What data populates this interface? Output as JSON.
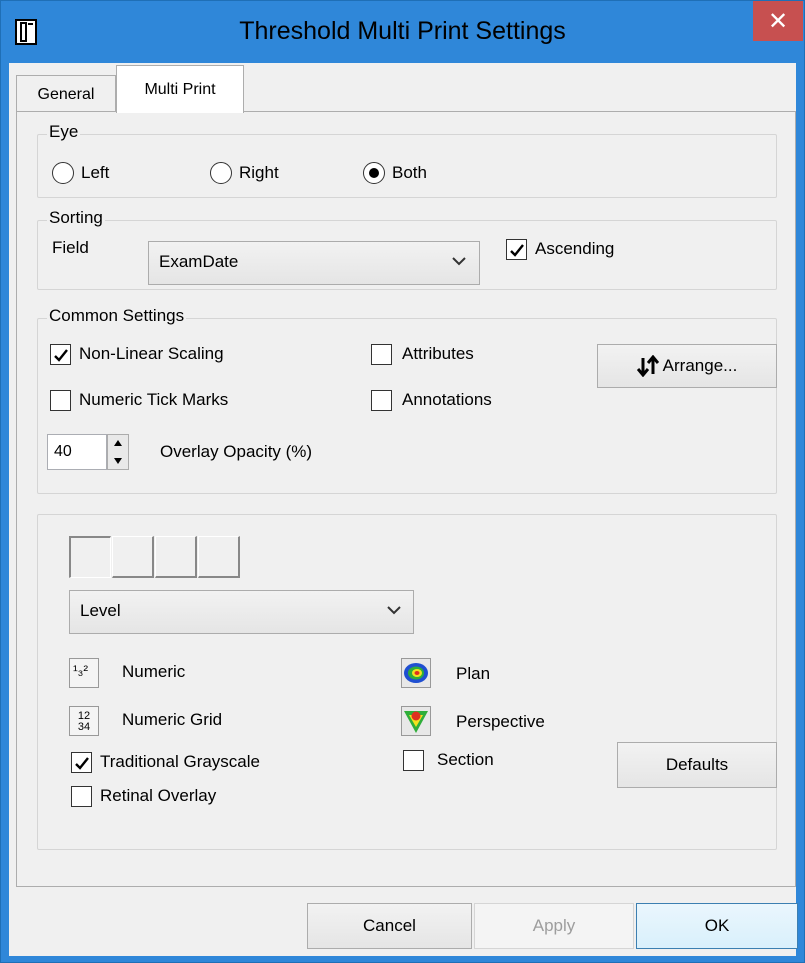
{
  "window": {
    "title": "Threshold Multi Print Settings",
    "close_glyph": "✕"
  },
  "tabs": [
    {
      "label": "General",
      "active": false
    },
    {
      "label": "Multi Print",
      "active": true
    }
  ],
  "eye": {
    "label": "Eye",
    "options": [
      {
        "label": "Left",
        "selected": false
      },
      {
        "label": "Right",
        "selected": false
      },
      {
        "label": "Both",
        "selected": true
      }
    ]
  },
  "sorting": {
    "label": "Sorting",
    "field_label": "Field",
    "field_value": "ExamDate",
    "ascending_label": "Ascending",
    "ascending_checked": true
  },
  "common": {
    "label": "Common Settings",
    "non_linear_scaling": {
      "label": "Non-Linear Scaling",
      "checked": true
    },
    "numeric_tick_marks": {
      "label": "Numeric Tick Marks",
      "checked": false
    },
    "attributes": {
      "label": "Attributes",
      "checked": false
    },
    "annotations": {
      "label": "Annotations",
      "checked": false
    },
    "arrange_label": "Arrange...",
    "arrange_icon": "sort-arrows-icon",
    "opacity_value": "40",
    "opacity_label": "Overlay Opacity (%)"
  },
  "layout": {
    "cells": 4,
    "selected_cell": 0,
    "view_value": "Level",
    "numeric_label": "Numeric",
    "numeric_grid_label": "Numeric Grid",
    "plan_label": "Plan",
    "perspective_label": "Perspective",
    "numeric_icon_text": "¹₃²",
    "numeric_grid_icon_text": "12 34",
    "traditional_grayscale": {
      "label": "Traditional Grayscale",
      "checked": true
    },
    "retinal_overlay": {
      "label": "Retinal Overlay",
      "checked": false
    },
    "section": {
      "label": "Section",
      "checked": false
    },
    "defaults_label": "Defaults"
  },
  "footer": {
    "cancel_label": "Cancel",
    "apply_label": "Apply",
    "ok_label": "OK"
  },
  "colors": {
    "titlebar": "#2f87d9",
    "close": "#c75050",
    "face": "#f0f0f0"
  }
}
